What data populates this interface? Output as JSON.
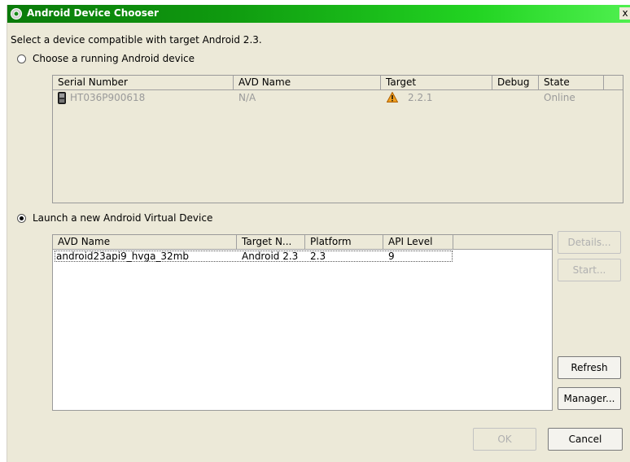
{
  "window": {
    "title": "Android Device Chooser",
    "close_label": "x"
  },
  "prompt": "Select a device compatible with target Android 2.3.",
  "running": {
    "radio_label": "Choose a running Android device",
    "columns": [
      "Serial Number",
      "AVD Name",
      "Target",
      "Debug",
      "State"
    ],
    "rows": [
      {
        "serial": "HT036P900618",
        "avd_name": "N/A",
        "target": "2.2.1",
        "debug": "",
        "state": "Online",
        "warning": true
      }
    ]
  },
  "launch": {
    "radio_label": "Launch a new Android Virtual Device",
    "columns": [
      "AVD Name",
      "Target N...",
      "Platform",
      "API Level"
    ],
    "rows": [
      {
        "avd_name": "android23api9_hvga_32mb",
        "target_name": "Android 2.3",
        "platform": "2.3",
        "api_level": "9"
      }
    ]
  },
  "buttons": {
    "details": "Details...",
    "start": "Start...",
    "refresh": "Refresh",
    "manager": "Manager...",
    "ok": "OK",
    "cancel": "Cancel"
  },
  "colors": {
    "title_gradient_start": "#0a7a0a",
    "title_gradient_end": "#4ff04f",
    "dialog_bg": "#ece9d8"
  },
  "icons": {
    "title": "android-gear-icon",
    "device": "phone-icon",
    "warning": "warning-icon"
  },
  "selection": {
    "mode": "launch"
  }
}
